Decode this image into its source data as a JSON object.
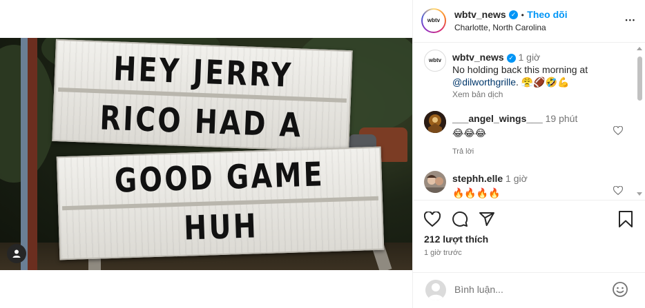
{
  "post": {
    "sign_lines": [
      "HEY JERRY",
      "RICO HAD A",
      "GOOD GAME",
      "HUH"
    ]
  },
  "header": {
    "username": "wbtv_news",
    "separator": "•",
    "follow_label": "Theo dõi",
    "location": "Charlotte, North Carolina",
    "more_label": "•••",
    "avatar_text": "wbtv"
  },
  "caption": {
    "username": "wbtv_news",
    "time": "1 giờ",
    "text_line1": "No holding back this morning at",
    "mention": "@dilworthgrille",
    "emojis": ". 😤🏈🤣💪",
    "translate_label": "Xem bản dịch"
  },
  "comments": [
    {
      "username": "___angel_wings___",
      "time": "19 phút",
      "text": "😂😂😂",
      "reply_label": "Trả lời"
    },
    {
      "username": "stephh.elle",
      "time": "1 giờ",
      "text": "🔥🔥🔥🔥"
    }
  ],
  "actions": {
    "likes": "212 lượt thích",
    "time_ago": "1 giờ trước"
  },
  "add_comment": {
    "placeholder": "Bình luận..."
  },
  "colors": {
    "accent": "#0095f6",
    "text": "#262626",
    "muted": "#737373",
    "border": "#efefef"
  }
}
